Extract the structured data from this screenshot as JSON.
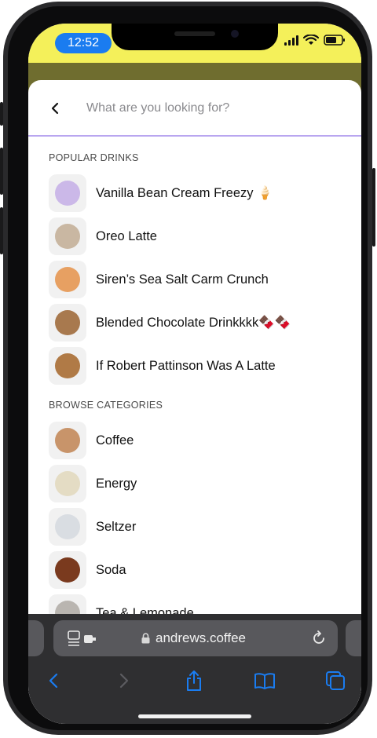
{
  "status_bar": {
    "time": "12:52"
  },
  "search": {
    "placeholder": "What are you looking for?",
    "value": ""
  },
  "popular": {
    "title": "POPULAR DRINKS",
    "items": [
      {
        "label": "Vanilla Bean Cream Freezy 🍦",
        "thumb_color": "#cbb8e8"
      },
      {
        "label": "Oreo Latte",
        "thumb_color": "#c9b7a2"
      },
      {
        "label": "Siren’s Sea Salt Carm Crunch",
        "thumb_color": "#e7a062"
      },
      {
        "label": "Blended Chocolate Drinkkkk🍫🍫",
        "thumb_color": "#a8794e"
      },
      {
        "label": "If Robert Pattinson Was A Latte",
        "thumb_color": "#b07a46"
      }
    ]
  },
  "categories": {
    "title": "BROWSE CATEGORIES",
    "items": [
      {
        "label": "Coffee",
        "thumb_color": "#c8946a"
      },
      {
        "label": "Energy",
        "thumb_color": "#e4dcc4"
      },
      {
        "label": "Seltzer",
        "thumb_color": "#d9dde2"
      },
      {
        "label": "Soda",
        "thumb_color": "#7a3a1e"
      },
      {
        "label": "Tea & Lemonade",
        "thumb_color": "#b9b5b0"
      }
    ]
  },
  "browser": {
    "url": "andrews.coffee"
  },
  "colors": {
    "accent_yellow": "#f4f05a",
    "divider_purple": "#b9a6f0",
    "browser_blue": "#1a7cf0"
  }
}
